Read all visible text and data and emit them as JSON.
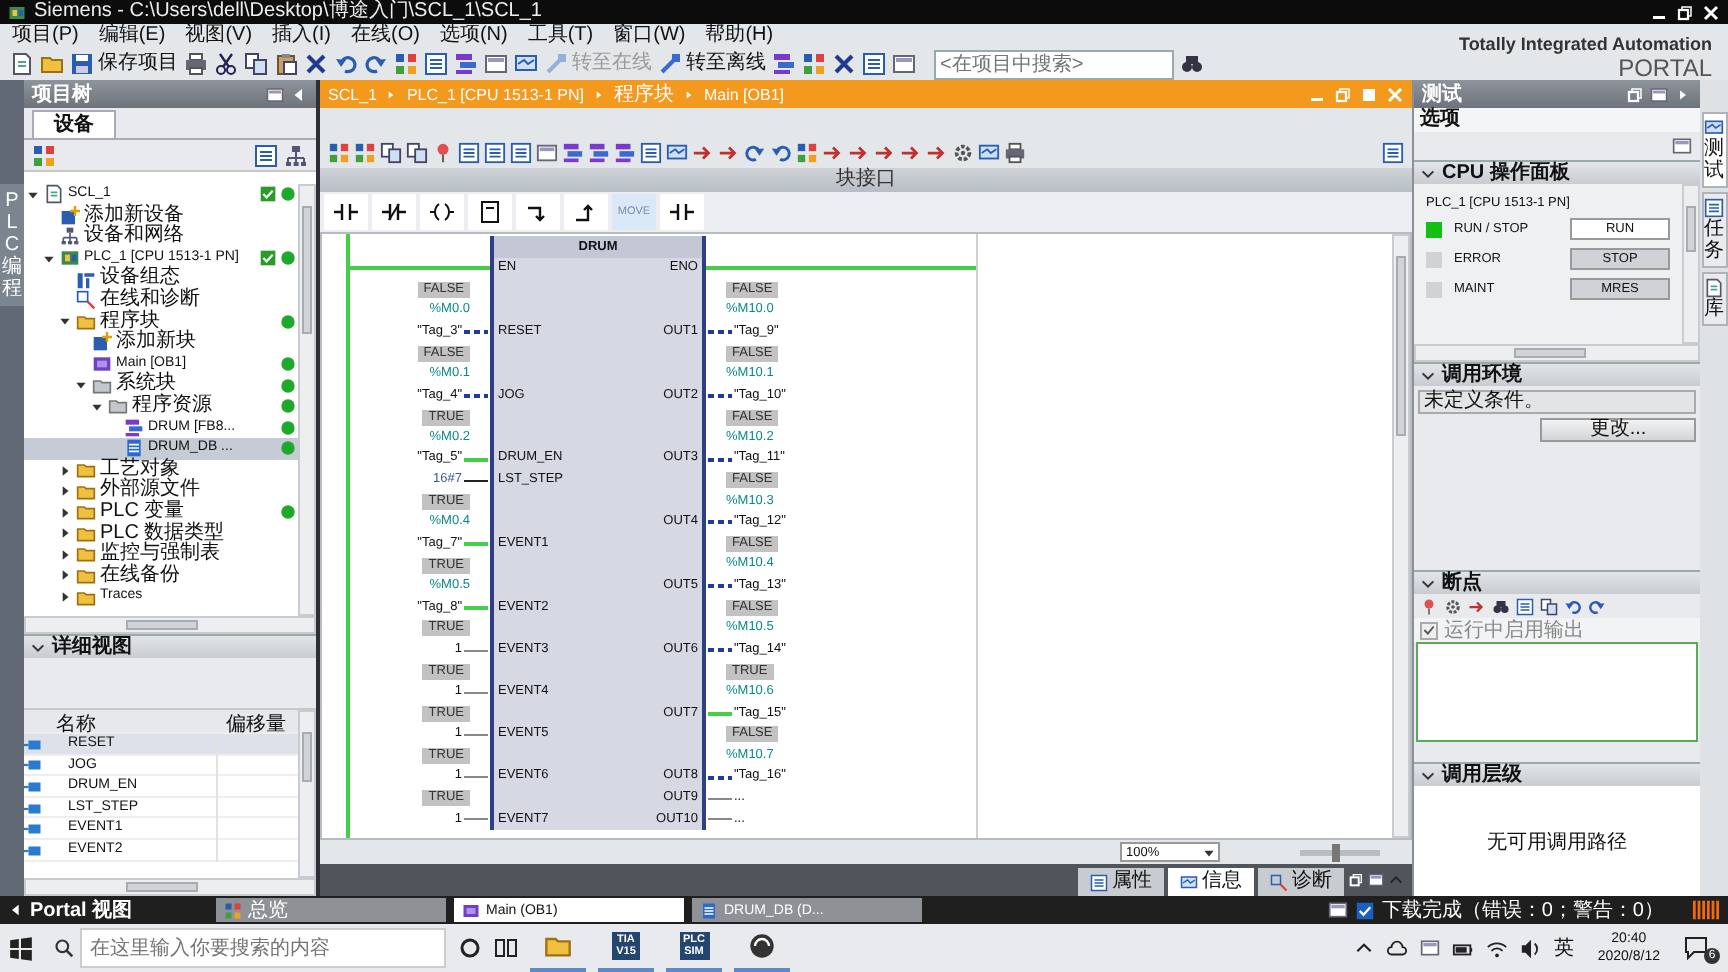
{
  "window": {
    "title": "Siemens  -  C:\\Users\\dell\\Desktop\\博途入门\\SCL_1\\SCL_1"
  },
  "menu": [
    "项目(P)",
    "编辑(E)",
    "视图(V)",
    "插入(I)",
    "在线(O)",
    "选项(N)",
    "工具(T)",
    "窗口(W)",
    "帮助(H)"
  ],
  "toolbar": {
    "save_label": "保存项目",
    "go_online": {
      "label": "转至在线",
      "disabled": true
    },
    "go_offline": {
      "label": "转至离线",
      "disabled": false
    },
    "search": {
      "placeholder": "<在项目中搜索>"
    }
  },
  "brand": {
    "line1": "Totally Integrated Automation",
    "line2": "PORTAL"
  },
  "left_strip": {
    "label": "PLC 编程"
  },
  "project_tree": {
    "title": "项目树",
    "tab": "设备",
    "items": [
      {
        "label": "SCL_1",
        "kind": "project",
        "expanded": true,
        "check": true,
        "dot": true,
        "selected": false,
        "children": [
          {
            "label": "添加新设备",
            "kind": "add",
            "check": false,
            "dot": false,
            "selected": false
          },
          {
            "label": "设备和网络",
            "kind": "network",
            "check": false,
            "dot": false,
            "selected": false
          },
          {
            "label": "PLC_1 [CPU 1513-1 PN]",
            "kind": "device",
            "expanded": true,
            "check": true,
            "dot": true,
            "selected": false,
            "children": [
              {
                "label": "设备组态",
                "kind": "config",
                "check": false,
                "dot": false,
                "selected": false
              },
              {
                "label": "在线和诊断",
                "kind": "diag",
                "check": false,
                "dot": false,
                "selected": false
              },
              {
                "label": "程序块",
                "kind": "folder",
                "expanded": true,
                "check": false,
                "dot": true,
                "selected": false,
                "children": [
                  {
                    "label": "添加新块",
                    "kind": "add",
                    "check": false,
                    "dot": false,
                    "selected": false
                  },
                  {
                    "label": "Main [OB1]",
                    "kind": "ob",
                    "check": false,
                    "dot": true,
                    "selected": false
                  },
                  {
                    "label": "系统块",
                    "kind": "system_folder",
                    "expanded": true,
                    "check": false,
                    "dot": true,
                    "selected": false,
                    "children": [
                      {
                        "label": "程序资源",
                        "kind": "system_folder",
                        "expanded": true,
                        "check": false,
                        "dot": true,
                        "selected": false,
                        "children": [
                          {
                            "label": "DRUM [FB8...",
                            "kind": "fb",
                            "check": false,
                            "dot": true,
                            "selected": false
                          },
                          {
                            "label": "DRUM_DB ...",
                            "kind": "db",
                            "check": false,
                            "dot": true,
                            "selected": true
                          }
                        ]
                      }
                    ]
                  }
                ]
              },
              {
                "label": "工艺对象",
                "kind": "folder",
                "expanded": false,
                "check": false,
                "dot": false,
                "selected": false
              },
              {
                "label": "外部源文件",
                "kind": "folder",
                "expanded": false,
                "check": false,
                "dot": false,
                "selected": false
              },
              {
                "label": "PLC 变量",
                "kind": "folder",
                "expanded": false,
                "check": false,
                "dot": true,
                "selected": false
              },
              {
                "label": "PLC 数据类型",
                "kind": "folder",
                "expanded": false,
                "check": false,
                "dot": false,
                "selected": false
              },
              {
                "label": "监控与强制表",
                "kind": "folder",
                "expanded": false,
                "check": false,
                "dot": false,
                "selected": false
              },
              {
                "label": "在线备份",
                "kind": "folder",
                "expanded": false,
                "check": false,
                "dot": false,
                "selected": false
              },
              {
                "label": "Traces",
                "kind": "folder",
                "expanded": false,
                "check": false,
                "dot": false,
                "selected": false
              }
            ]
          }
        ]
      }
    ]
  },
  "detail_view": {
    "title": "详细视图",
    "expanded": true,
    "columns": [
      "名称",
      "偏移量"
    ],
    "rows": [
      {
        "name": "RESET",
        "selected": true
      },
      {
        "name": "JOG",
        "selected": false
      },
      {
        "name": "DRUM_EN",
        "selected": false
      },
      {
        "name": "LST_STEP",
        "selected": false
      },
      {
        "name": "EVENT1",
        "selected": false
      },
      {
        "name": "EVENT2",
        "selected": false
      }
    ]
  },
  "editor": {
    "breadcrumb": [
      "SCL_1",
      "PLC_1 [CPU 1513-1 PN]",
      "程序块",
      "Main [OB1]"
    ],
    "interface_bar": "块接口",
    "palette_label": "MOVE",
    "network": {
      "block": "DRUM",
      "en": "EN",
      "eno": "ENO",
      "en_powered": true,
      "eno_powered": true,
      "inputs": [
        {
          "pin": "RESET",
          "kind": "tag",
          "state": "FALSE",
          "address": "%M0.0",
          "operand": "\"Tag_3\"",
          "powered": false
        },
        {
          "pin": "JOG",
          "kind": "tag",
          "state": "FALSE",
          "address": "%M0.1",
          "operand": "\"Tag_4\"",
          "powered": false
        },
        {
          "pin": "DRUM_EN",
          "kind": "tag",
          "state": "TRUE",
          "address": "%M0.2",
          "operand": "\"Tag_5\"",
          "powered": true
        },
        {
          "pin": "LST_STEP",
          "kind": "constant",
          "operand": "16#7"
        },
        {
          "pin": "EVENT1",
          "kind": "tag",
          "state": "TRUE",
          "address": "%M0.4",
          "operand": "\"Tag_7\"",
          "powered": true
        },
        {
          "pin": "EVENT2",
          "kind": "tag",
          "state": "TRUE",
          "address": "%M0.5",
          "operand": "\"Tag_8\"",
          "powered": true
        },
        {
          "pin": "EVENT3",
          "kind": "constant_state",
          "state": "TRUE",
          "operand": "1"
        },
        {
          "pin": "EVENT4",
          "kind": "constant_state",
          "state": "TRUE",
          "operand": "1"
        },
        {
          "pin": "EVENT5",
          "kind": "constant_state",
          "state": "TRUE",
          "operand": "1"
        },
        {
          "pin": "EVENT6",
          "kind": "constant_state",
          "state": "TRUE",
          "operand": "1"
        },
        {
          "pin": "EVENT7",
          "kind": "constant_state",
          "state": "TRUE",
          "operand": "1"
        }
      ],
      "outputs": [
        {
          "pin": "OUT1",
          "kind": "tag",
          "state": "FALSE",
          "address": "%M10.0",
          "operand": "\"Tag_9\"",
          "powered": false
        },
        {
          "pin": "OUT2",
          "kind": "tag",
          "state": "FALSE",
          "address": "%M10.1",
          "operand": "\"Tag_10\"",
          "powered": false
        },
        {
          "pin": "OUT3",
          "kind": "tag",
          "state": "FALSE",
          "address": "%M10.2",
          "operand": "\"Tag_11\"",
          "powered": false
        },
        {
          "pin": "OUT4",
          "kind": "tag",
          "state": "FALSE",
          "address": "%M10.3",
          "operand": "\"Tag_12\"",
          "powered": false
        },
        {
          "pin": "OUT5",
          "kind": "tag",
          "state": "FALSE",
          "address": "%M10.4",
          "operand": "\"Tag_13\"",
          "powered": false
        },
        {
          "pin": "OUT6",
          "kind": "tag",
          "state": "FALSE",
          "address": "%M10.5",
          "operand": "\"Tag_14\"",
          "powered": false
        },
        {
          "pin": "OUT7",
          "kind": "tag",
          "state": "TRUE",
          "address": "%M10.6",
          "operand": "\"Tag_15\"",
          "powered": true
        },
        {
          "pin": "OUT8",
          "kind": "tag",
          "state": "FALSE",
          "address": "%M10.7",
          "operand": "\"Tag_16\"",
          "powered": false
        },
        {
          "pin": "OUT9",
          "kind": "open",
          "operand": "..."
        },
        {
          "pin": "OUT10",
          "kind": "open",
          "operand": "..."
        }
      ]
    },
    "zoom": "100%",
    "zoom_slider": {
      "level": 0.45
    },
    "bottom_tabs": [
      {
        "label": "属性",
        "selected": false
      },
      {
        "label": "信息",
        "selected": true
      },
      {
        "label": "诊断",
        "selected": false
      }
    ]
  },
  "test_panel": {
    "title": "测试",
    "options": "选项",
    "cpu_panel": {
      "title": "CPU 操作面板",
      "expanded": true,
      "device": "PLC_1 [CPU 1513-1 PN]",
      "rows": [
        {
          "label": "RUN / STOP",
          "lit": true,
          "button": "RUN",
          "pressed": true
        },
        {
          "label": "ERROR",
          "lit": false,
          "button": "STOP",
          "pressed": false
        },
        {
          "label": "MAINT",
          "lit": false,
          "button": "MRES",
          "pressed": false
        }
      ]
    },
    "call_env": {
      "title": "调用环境",
      "expanded": true,
      "condition": "未定义条件。",
      "button": "更改..."
    },
    "breakpoints": {
      "title": "断点",
      "expanded": true,
      "option": {
        "label": "运行中启用输出",
        "checked": true,
        "disabled": true
      }
    },
    "call_hierarchy": {
      "title": "调用层级",
      "expanded": true,
      "message": "无可用调用路径"
    }
  },
  "right_strip": [
    {
      "label": "测试",
      "selected": true
    },
    {
      "label": "任务",
      "selected": false
    },
    {
      "label": "库",
      "selected": false
    }
  ],
  "portal_bar": {
    "label": "Portal 视图",
    "tabs": [
      {
        "label": "总览",
        "kind": "overview",
        "selected": false
      },
      {
        "label": "Main (OB1)",
        "kind": "ob",
        "selected": true
      },
      {
        "label": "DRUM_DB (D...",
        "kind": "db",
        "selected": false
      }
    ],
    "status": "下载完成（错误：0；警告：0）"
  },
  "taskbar": {
    "search_placeholder": "在这里输入你要搜索的内容",
    "apps": [
      {
        "kind": "explorer",
        "active": true
      },
      {
        "kind": "tile",
        "lines": [
          "TIA",
          "V15"
        ],
        "active": true
      },
      {
        "kind": "tile",
        "lines": [
          "PLC",
          "SIM"
        ],
        "active": true
      },
      {
        "kind": "media",
        "active": true
      }
    ],
    "ime": "英",
    "time": "20:40",
    "date": "2020/8/12",
    "notifications": "6"
  }
}
